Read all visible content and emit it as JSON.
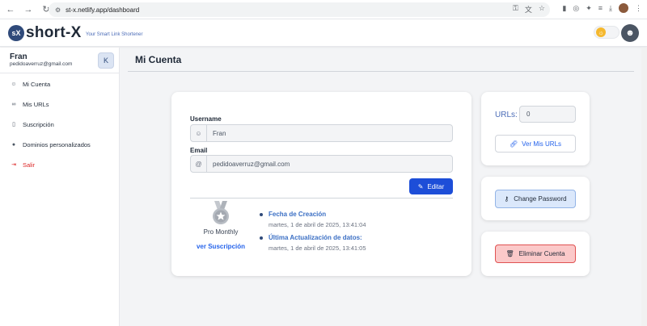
{
  "browser": {
    "url": "st-x.netlify.app/dashboard",
    "back_icon": "arrow-left-icon",
    "forward_icon": "arrow-right-icon",
    "reload_icon": "reload-icon"
  },
  "header": {
    "logo_mark": "sX",
    "logo_text": "short-X",
    "tagline": "Your Smart Link Shortener"
  },
  "sidebar": {
    "user_name": "Fran",
    "user_email": "pedidoaverruz@gmail.com",
    "collapse_label": "K",
    "items": [
      {
        "label": "Mi Cuenta",
        "icon": "user-icon",
        "glyph": "☺"
      },
      {
        "label": "Mis URLs",
        "icon": "link-icon",
        "glyph": "∞"
      },
      {
        "label": "Suscripción",
        "icon": "bookmark-icon",
        "glyph": "▯"
      },
      {
        "label": "Dominios personalizados",
        "icon": "globe-icon",
        "glyph": "●"
      },
      {
        "label": "Salir",
        "icon": "logout-icon",
        "glyph": "⇥"
      }
    ]
  },
  "main": {
    "page_title": "Mi Cuenta",
    "username_label": "Username",
    "username_value": "Fran",
    "email_label": "Email",
    "email_value": "pedidoaverruz@gmail.com",
    "email_icon_glyph": "@",
    "user_icon_glyph": "☺",
    "edit_label": "Editar",
    "plan_name": "Pro Monthly",
    "plan_link": "ver Suscripción",
    "created_title": "Fecha de Creación",
    "created_value": "martes, 1 de abril de 2025, 13:41:04",
    "updated_title": "Última Actualización de datos:",
    "updated_value": "martes, 1 de abril de 2025, 13:41:05"
  },
  "right": {
    "urls_label": "URLs:",
    "urls_count": "0",
    "view_urls_label": "Ver Mis URLs",
    "change_password_label": "Change Password",
    "delete_account_label": "Eliminar Cuenta"
  },
  "colors": {
    "primary": "#1d4ed8",
    "link": "#2563eb",
    "danger": "#dc2626",
    "danger_bg": "#fbc9c9",
    "secondary_bg": "#dbe8fb"
  }
}
